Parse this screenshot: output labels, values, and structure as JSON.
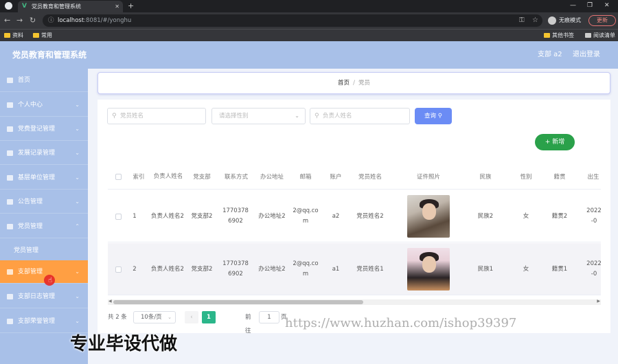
{
  "browser": {
    "tab_title": "党员教育和管理系统",
    "tab_close": "✕",
    "new_tab": "+",
    "url_host": "localhost",
    "url_path": ":8081/#/yonghu",
    "profile_label": "无痕模式",
    "update_label": "更新",
    "win_min": "—",
    "win_max": "❐",
    "win_close": "✕",
    "bookmarks": [
      {
        "label": "资料"
      },
      {
        "label": "常用"
      }
    ],
    "bookmark_other": "其他书签",
    "reading_list": "阅读清单"
  },
  "header": {
    "app_title": "党员教育和管理系统",
    "user": "支部 a2",
    "logout": "退出登录"
  },
  "sidebar": {
    "items": [
      {
        "label": "首页"
      },
      {
        "label": "个人中心"
      },
      {
        "label": "党费登记管理"
      },
      {
        "label": "发展记录管理"
      },
      {
        "label": "基层单位管理"
      },
      {
        "label": "公告管理"
      },
      {
        "label": "党员管理"
      },
      {
        "label": "党员管理"
      },
      {
        "label": "支部管理"
      },
      {
        "label": "支部日志管理"
      },
      {
        "label": "支部荣誉管理"
      }
    ]
  },
  "breadcrumb": {
    "home": "首页",
    "sep": "/",
    "current": "党员"
  },
  "search": {
    "name_placeholder": "党员姓名",
    "gender_placeholder": "请选择性别",
    "leader_placeholder": "负责人姓名",
    "query_label": "查询",
    "add_label": "新增"
  },
  "table": {
    "columns": [
      "索引",
      "负责人姓名",
      "党支部",
      "联系方式",
      "办公地址",
      "邮箱",
      "账户",
      "党员姓名",
      "证件照片",
      "民族",
      "性别",
      "籍贯",
      "出生"
    ],
    "rows": [
      {
        "index": "1",
        "leader": "负责人姓名2",
        "branch": "党支部2",
        "phone": "17703786902",
        "office": "办公地址2",
        "email": "2@qq.com",
        "account": "a2",
        "member": "党员姓名2",
        "ethnicity": "民族2",
        "gender": "女",
        "native": "籍贯2",
        "birth": "2022-0"
      },
      {
        "index": "2",
        "leader": "负责人姓名2",
        "branch": "党支部2",
        "phone": "17703786902",
        "office": "办公地址2",
        "email": "2@qq.com",
        "account": "a1",
        "member": "党员姓名1",
        "ethnicity": "民族1",
        "gender": "女",
        "native": "籍贯1",
        "birth": "2022-0"
      }
    ]
  },
  "pager": {
    "total": "共 2 条",
    "page_size": "10条/页",
    "prev": "‹",
    "current_page": "1",
    "goto": "前往",
    "goto_value": "1",
    "page_unit": "页"
  },
  "watermark": {
    "url": "https://www.huzhan.com/ishop39397",
    "text": "专业毕设代做"
  }
}
